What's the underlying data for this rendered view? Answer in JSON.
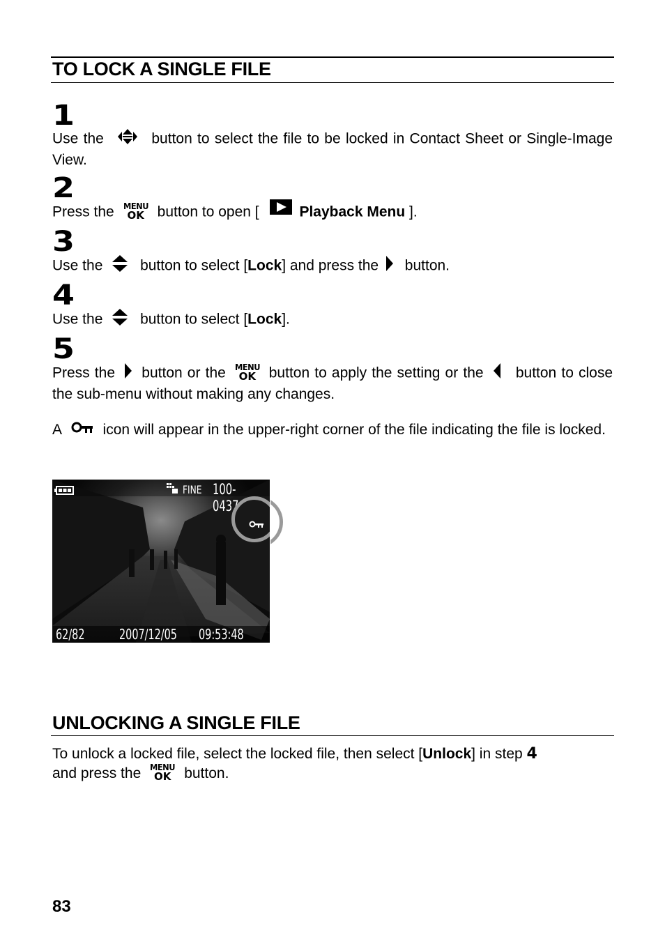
{
  "section1": {
    "heading": "TO LOCK A SINGLE FILE",
    "steps": [
      {
        "number": "1",
        "parts": [
          "Use the",
          "button to select the file to be locked in Contact Sheet or Single-Image View."
        ],
        "icons": [
          "four-way-dpad-icon"
        ]
      },
      {
        "number": "2",
        "parts": [
          "Press the",
          "button to open [",
          "Playback Menu",
          "]."
        ],
        "icons": [
          "menu-ok-button-icon",
          "playback-icon"
        ]
      },
      {
        "number": "3",
        "parts": [
          "Use the",
          "button to select [",
          "Lock",
          "] and press the",
          "button."
        ],
        "icons": [
          "up-down-button-icon",
          "right-arrow-button-icon"
        ]
      },
      {
        "number": "4",
        "parts": [
          "Use the",
          "button to select [",
          "Lock",
          "]."
        ],
        "icons": [
          "up-down-button-icon"
        ]
      },
      {
        "number": "5",
        "parts": [
          "Press the",
          "button or the",
          "button to apply the setting or the",
          "button to close the sub-menu without making any changes."
        ],
        "icons": [
          "right-arrow-button-icon",
          "menu-ok-button-icon",
          "left-arrow-button-icon"
        ]
      }
    ],
    "note": {
      "parts": [
        "A",
        "icon will appear in the upper-right corner of the file indicating the file is locked."
      ],
      "icon": "key-lock-icon"
    }
  },
  "menu_ok_icon": {
    "top": "MENU",
    "bottom": "OK"
  },
  "screen": {
    "battery": "battery-full-icon",
    "quality_icon": "image-size-icon",
    "quality": "FINE",
    "file_number": "100-0437",
    "lock_icon": "key-lock-icon",
    "frame_count": "62/82",
    "date": "2007/12/05",
    "time": "09:53:48 AM",
    "highlight_color": "#9a9a9a"
  },
  "section2": {
    "heading": "UNLOCKING A SINGLE FILE",
    "parts": [
      "To unlock a locked file, select the locked file, then select [",
      "Unlock",
      "] in step",
      "4",
      "and press the",
      "button."
    ]
  },
  "page_number": "83"
}
